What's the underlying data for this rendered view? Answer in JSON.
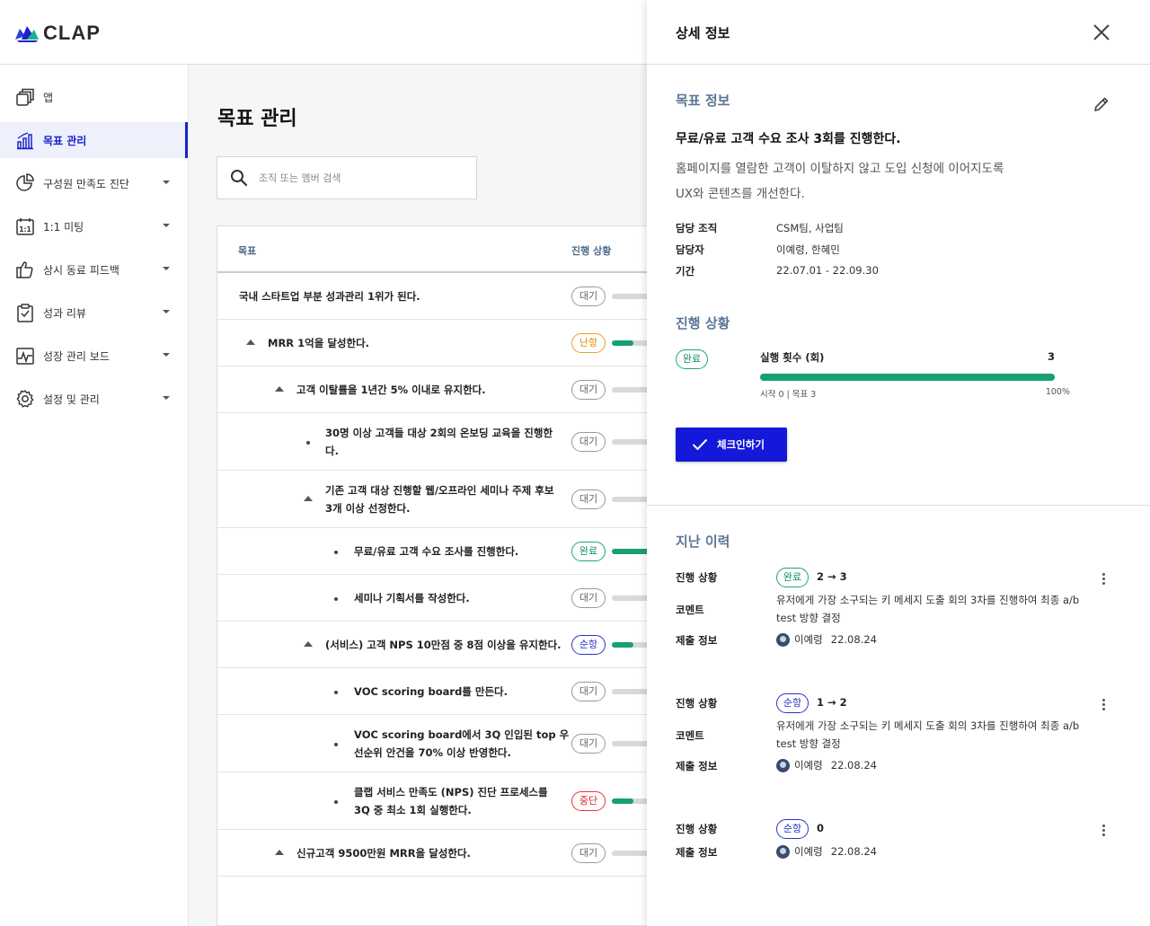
{
  "brand": {
    "name": "CLAP"
  },
  "sidebar": {
    "items": [
      {
        "label": "앱",
        "icon": "apps-icon",
        "has_caret": false,
        "active": false
      },
      {
        "label": "목표 관리",
        "icon": "goal-chart-icon",
        "has_caret": false,
        "active": true
      },
      {
        "label": "구성원 만족도 진단",
        "icon": "pie-chart-icon",
        "has_caret": true,
        "active": false
      },
      {
        "label": "1:1 미팅",
        "icon": "calendar-icon",
        "has_caret": true,
        "active": false
      },
      {
        "label": "상시 동료 피드백",
        "icon": "thumbs-up-icon",
        "has_caret": true,
        "active": false
      },
      {
        "label": "성과 리뷰",
        "icon": "clipboard-icon",
        "has_caret": true,
        "active": false
      },
      {
        "label": "성장 관리 보드",
        "icon": "activity-board-icon",
        "has_caret": true,
        "active": false
      },
      {
        "label": "설정 및 관리",
        "icon": "gear-icon",
        "has_caret": true,
        "active": false
      }
    ]
  },
  "main": {
    "title": "목표 관리",
    "search_placeholder": "조직 또는 멤버 검색",
    "columns": {
      "goal": "목표",
      "status": "진행 상황"
    },
    "rows": [
      {
        "text_lines": [
          "국내 스타트업 부분 성과관리 1위가 된다."
        ],
        "status": "대기",
        "status_kind": "wait",
        "progress": 0
      },
      {
        "text_lines": [
          "MRR 1억을 달성한다."
        ],
        "status": "난항",
        "status_kind": "warn",
        "progress": 0.4
      },
      {
        "text_lines": [
          "고객 이탈률을 1년간 5% 이내로 유지한다."
        ],
        "status": "대기",
        "status_kind": "wait",
        "progress": 0
      },
      {
        "text_lines": [
          "30명 이상 고객들 대상 2회의 온보딩 교육을 진행한",
          "다."
        ],
        "status": "대기",
        "status_kind": "wait",
        "progress": 0
      },
      {
        "text_lines": [
          "기존 고객 대상 진행할 웹/오프라인 세미나 주제 후보",
          "3개 이상 선정한다."
        ],
        "status": "대기",
        "status_kind": "wait",
        "progress": 0
      },
      {
        "text_lines": [
          "무료/유료 고객 수요 조사를 진행한다."
        ],
        "status": "완료",
        "status_kind": "done",
        "progress": 1
      },
      {
        "text_lines": [
          "세미나 기획서를 작성한다."
        ],
        "status": "대기",
        "status_kind": "wait",
        "progress": 0
      },
      {
        "text_lines": [
          "(서비스) 고객 NPS 10만점 중 8점 이상을 유지한다."
        ],
        "status": "순항",
        "status_kind": "good",
        "progress": 0.4
      },
      {
        "text_lines": [
          "VOC scoring board를 만든다."
        ],
        "status": "대기",
        "status_kind": "wait",
        "progress": 0
      },
      {
        "text_lines": [
          "VOC scoring board에서 3Q 인입된 top 우",
          "선순위 안건을 70% 이상 반영한다."
        ],
        "status": "대기",
        "status_kind": "wait",
        "progress": 0
      },
      {
        "text_lines": [
          "클랩 서비스 만족도 (NPS) 진단 프로세스를",
          "3Q 중 최소 1회 실행한다."
        ],
        "status": "중단",
        "status_kind": "stop",
        "progress": 0.4
      },
      {
        "text_lines": [
          "신규고객 9500만원 MRR을 달성한다."
        ],
        "status": "대기",
        "status_kind": "wait",
        "progress": 0
      }
    ]
  },
  "panel": {
    "title": "상세 정보",
    "goal_info_title": "목표 정보",
    "goal_title": "무료/유료 고객 수요 조사 3회를 진행한다.",
    "goal_desc_lines": [
      "홈페이지를 열람한 고객이 이탈하지 않고 도입 신청에 이어지도록",
      "UX와 콘텐츠를 개선한다."
    ],
    "info": [
      {
        "key": "담당 조직",
        "value": "CSM팀, 사업팀"
      },
      {
        "key": "담당자",
        "value": "이예령, 한혜민"
      },
      {
        "key": "기간",
        "value": "22.07.01 - 22.09.30"
      }
    ],
    "progress_title": "진행 상황",
    "progress": {
      "status": "완료",
      "metric_label": "실행 횟수 (회)",
      "current": "3",
      "fraction": 1,
      "start_target": "시작 0 | 목표 3",
      "percent": "100%"
    },
    "checkin_label": "체크인하기",
    "history_title": "지난 이력",
    "history_labels": {
      "status": "진행 상황",
      "comment": "코멘트",
      "submit": "제출 정보"
    },
    "history": [
      {
        "status": "완료",
        "status_kind": "done",
        "change": "2 → 3",
        "comment_lines": [
          "유저에게 가장 소구되는 키 메세지 도출 회의 3차를 진행하여 최종 a/b",
          "test 방향 결정"
        ],
        "author": "이예령",
        "date": "22.08.24"
      },
      {
        "status": "순항",
        "status_kind": "good",
        "change": "1 → 2",
        "comment_lines": [
          "유저에게 가장 소구되는 키 메세지 도출 회의 3차를 진행하여 최종 a/b",
          "test 방향 결정"
        ],
        "author": "이예령",
        "date": "22.08.24"
      },
      {
        "status": "순항",
        "status_kind": "good",
        "change": "0",
        "comment_lines": [],
        "author": "이예령",
        "date": "22.08.24"
      }
    ]
  },
  "colors": {
    "accent": "#1a22c8",
    "done": "#17a072",
    "warn": "#e08a00",
    "good": "#2733c4",
    "stop": "#e02020",
    "section_title": "#5a7595"
  }
}
